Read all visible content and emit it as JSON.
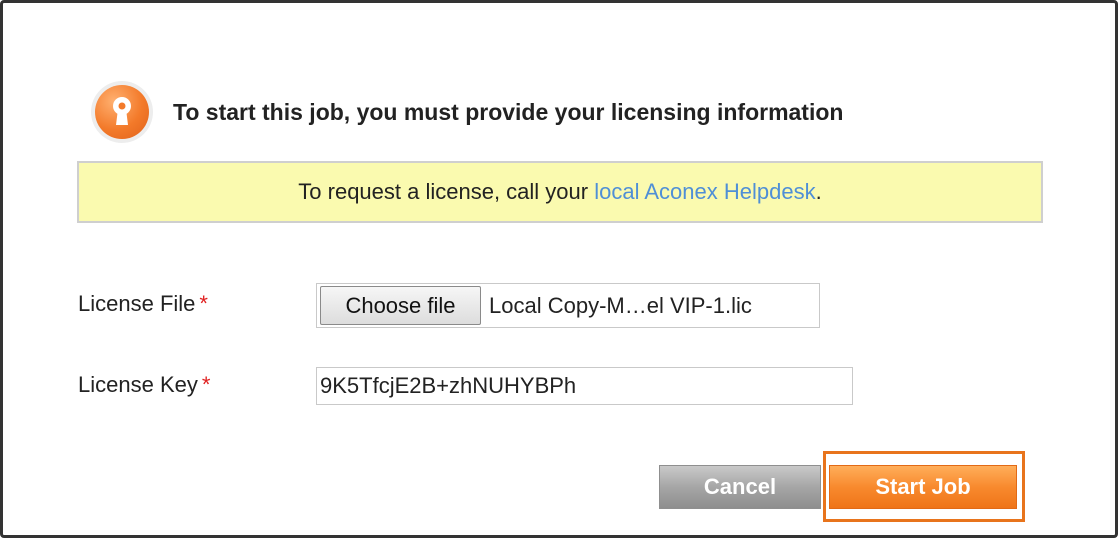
{
  "dialog": {
    "title": "To start this job, you must provide your licensing information",
    "icon": "lock-icon",
    "accent_color": "#f37a2a"
  },
  "notice": {
    "text_before": "To request a license, call your ",
    "link_text": "local Aconex Helpdesk",
    "text_after": ".",
    "background": "#fafaaf",
    "link_color": "#4f8fd6"
  },
  "form": {
    "license_file": {
      "label": "License File",
      "required_marker": "*",
      "button_label": "Choose file",
      "file_name": "Local Copy-M…el VIP-1.lic"
    },
    "license_key": {
      "label": "License Key",
      "required_marker": "*",
      "value": "9K5TfcjE2B+zhNUHYBPh"
    }
  },
  "actions": {
    "cancel_label": "Cancel",
    "start_label": "Start Job"
  }
}
